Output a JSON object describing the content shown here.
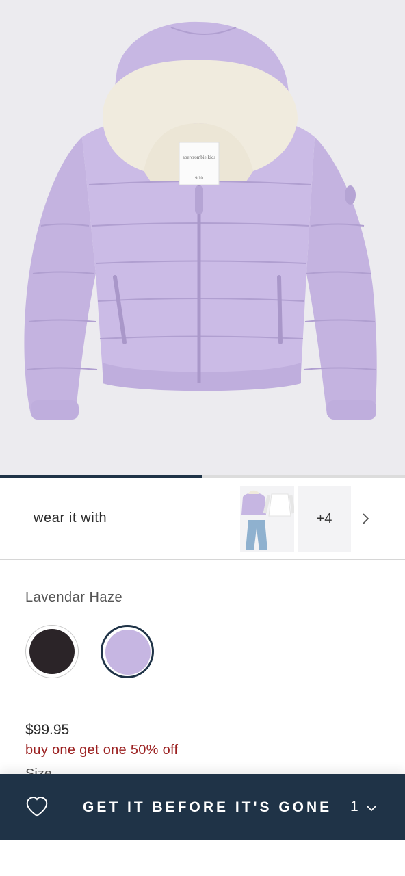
{
  "product": {
    "image_alt": "Lavender hooded puffer jacket with sherpa lining",
    "image_label_brand": "abercrombie kids",
    "image_label_size": "9/10",
    "carousel_progress": 0.5
  },
  "wear_it_with": {
    "label": "wear it with",
    "more_count": "+4"
  },
  "color": {
    "selected_name": "Lavendar Haze",
    "swatches": [
      {
        "name": "black",
        "hex": "#2b2428",
        "selected": false
      },
      {
        "name": "lavender",
        "hex": "#c6b6e2",
        "selected": true
      }
    ]
  },
  "pricing": {
    "price": "$99.95",
    "promo": "buy one get one 50% off"
  },
  "size_label": "Size",
  "cta": {
    "label": "GET IT BEFORE IT'S GONE",
    "quantity": "1"
  },
  "colors": {
    "navy": "#1f3347",
    "promo_red": "#9b2020",
    "jacket": "#c6b6e2"
  }
}
